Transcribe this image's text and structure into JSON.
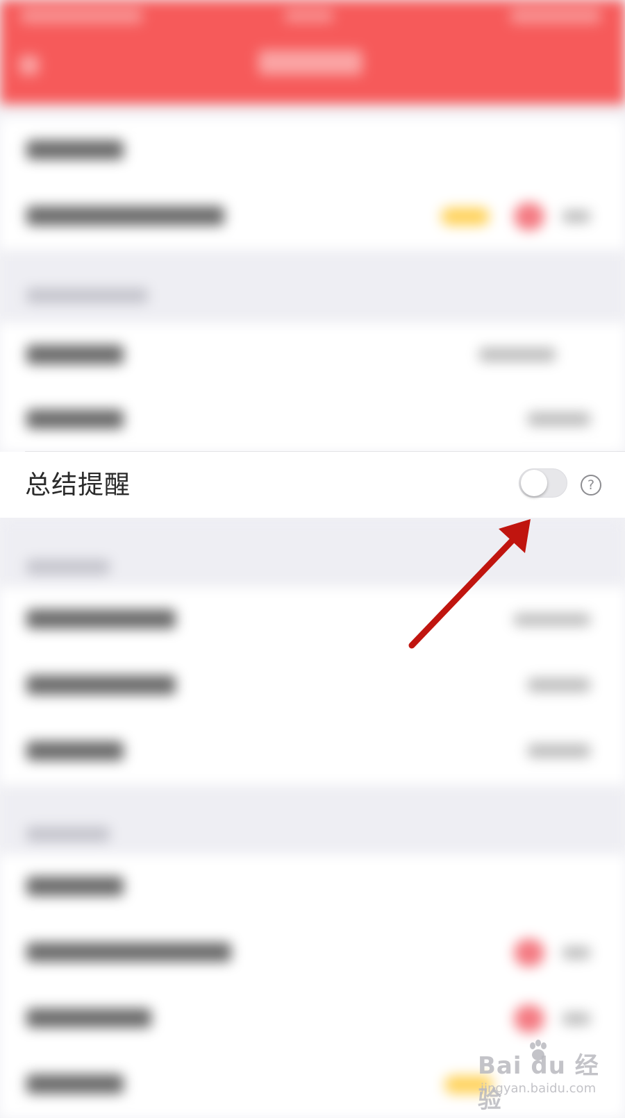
{
  "setting_row": {
    "label": "总结提醒",
    "toggle_state": "off"
  },
  "help_icon": {
    "glyph": "?"
  },
  "annotation": {
    "arrow_color": "#c0150f"
  },
  "watermark": {
    "brand": "Bai du 经验",
    "url": "jingyan.baidu.com"
  },
  "colors": {
    "header_red": "#f65a5a",
    "background": "#f2f2f6"
  }
}
